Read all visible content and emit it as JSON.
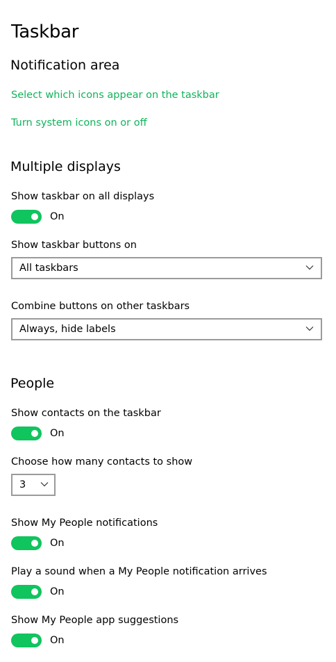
{
  "page": {
    "title": "Taskbar"
  },
  "notification_area": {
    "heading": "Notification area",
    "links": [
      "Select which icons appear on the taskbar",
      "Turn system icons on or off"
    ]
  },
  "multiple_displays": {
    "heading": "Multiple displays",
    "show_taskbar_all": {
      "label": "Show taskbar on all displays",
      "state": "On",
      "on": true
    },
    "show_buttons_on": {
      "label": "Show taskbar buttons on",
      "value": "All taskbars"
    },
    "combine_buttons": {
      "label": "Combine buttons on other taskbars",
      "value": "Always, hide labels"
    }
  },
  "people": {
    "heading": "People",
    "show_contacts": {
      "label": "Show contacts on the taskbar",
      "state": "On",
      "on": true
    },
    "contacts_count": {
      "label": "Choose how many contacts to show",
      "value": "3"
    },
    "notifications": {
      "label": "Show My People notifications",
      "state": "On",
      "on": true
    },
    "sound": {
      "label": "Play a sound when a My People notification arrives",
      "state": "On",
      "on": true
    },
    "suggestions": {
      "label": "Show My People app suggestions",
      "state": "On",
      "on": true
    }
  },
  "colors": {
    "accent": "#10c45e",
    "link": "#10b35a",
    "border": "#9a9a9a"
  },
  "icons": {
    "dropdown": "chevron-down-icon"
  }
}
